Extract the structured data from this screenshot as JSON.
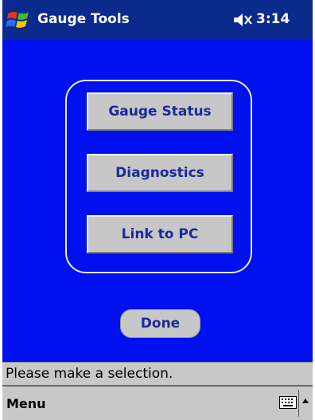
{
  "title_bar": {
    "title": "Gauge Tools",
    "time": "3:14",
    "start_icon": "windows-flag-icon",
    "volume_icon": "speaker-muted-icon"
  },
  "main": {
    "buttons": [
      {
        "label": "Gauge Status"
      },
      {
        "label": "Diagnostics"
      },
      {
        "label": "Link to PC"
      }
    ],
    "done_label": "Done"
  },
  "status": {
    "text": "Please make a selection."
  },
  "menu_bar": {
    "menu_label": "Menu",
    "keyboard_icon": "keyboard-icon",
    "sip_icon": "up-arrow-icon"
  },
  "colors": {
    "title_bar": "#0a2a8c",
    "background": "#0010ee",
    "button_face": "#c7c7c7",
    "button_text": "#1a2a9a"
  }
}
